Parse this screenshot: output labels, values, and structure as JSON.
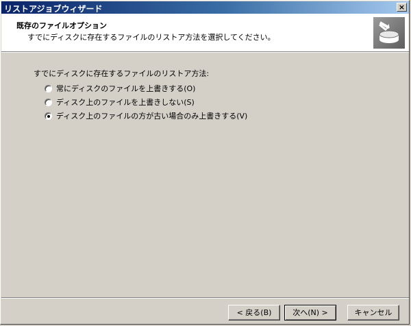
{
  "window": {
    "title": "リストアジョブウィザード",
    "close_label": "×"
  },
  "header": {
    "title": "既存のファイルオプション",
    "subtitle": "すでにディスクに存在するファイルのリストア方法を選択してください。",
    "icon": "restore-wizard-icon"
  },
  "options": {
    "prompt": "すでにディスクに存在するファイルのリストア方法:",
    "items": [
      {
        "label": "常にディスクのファイルを上書きする(O)",
        "checked": false
      },
      {
        "label": "ディスク上のファイルを上書きしない(S)",
        "checked": false
      },
      {
        "label": "ディスク上のファイルの方が古い場合のみ上書きする(V)",
        "checked": true
      }
    ]
  },
  "buttons": {
    "back": "< 戻る(B)",
    "next": "次へ(N) >",
    "cancel": "キャンセル"
  },
  "colors": {
    "titlebar_start": "#0a246a",
    "titlebar_end": "#a6caf0",
    "face": "#d4d0c8"
  }
}
